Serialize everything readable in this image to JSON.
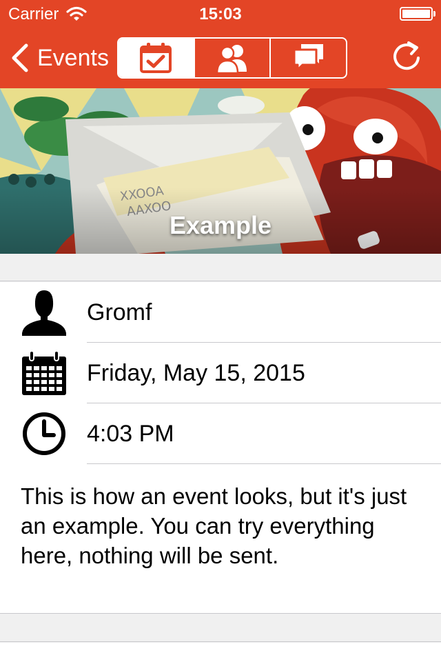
{
  "status_bar": {
    "carrier": "Carrier",
    "time": "15:03"
  },
  "nav": {
    "back_label": "Events",
    "segments": [
      {
        "icon": "calendar-check-icon",
        "active": true
      },
      {
        "icon": "people-icon",
        "active": false
      },
      {
        "icon": "chat-bubbles-icon",
        "active": false
      }
    ],
    "refresh_icon": "refresh-icon"
  },
  "hero": {
    "title": "Example"
  },
  "details": {
    "organizer": "Gromf",
    "date": "Friday, May 15, 2015",
    "time": "4:03 PM",
    "description": "This is how an event looks, but it's just an example. You can try everything here, nothing will be sent."
  },
  "colors": {
    "accent": "#e34526",
    "separator": "#c8c8cc",
    "background": "#f0f0f0"
  }
}
